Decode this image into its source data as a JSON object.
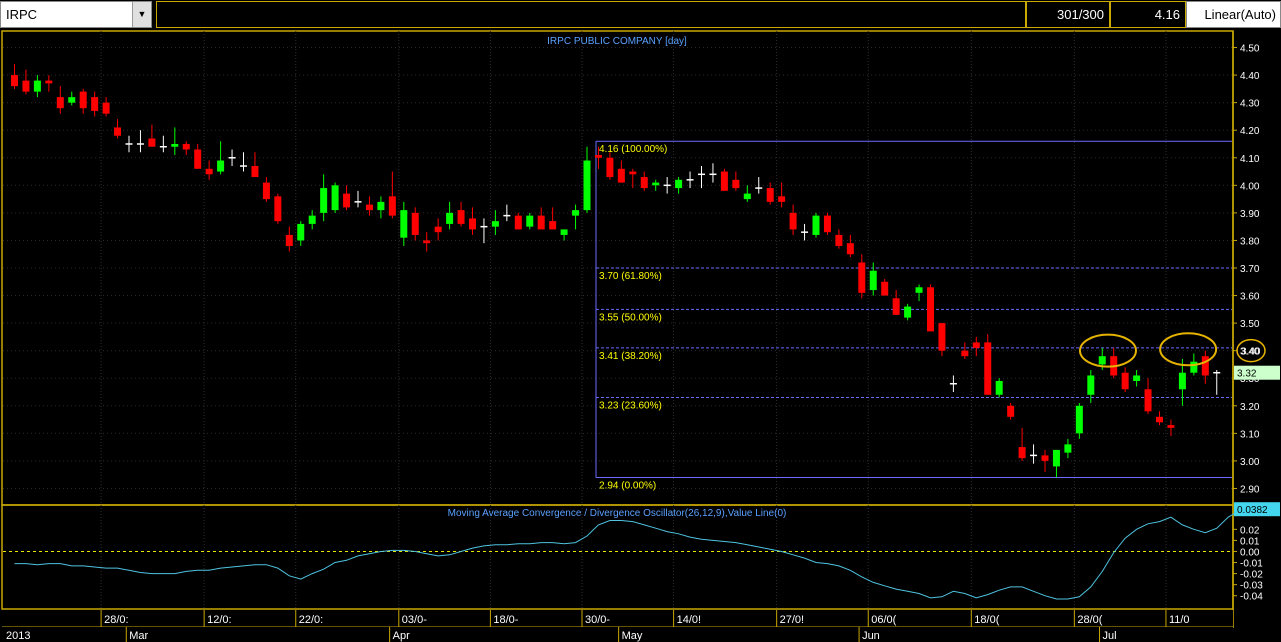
{
  "toolbar": {
    "symbol": "IRPC",
    "bars_count": "301/300",
    "last_value": "4.16",
    "scale_mode": "Linear(Auto)"
  },
  "chart_data": [
    {
      "type": "candlestick",
      "title": "IRPC PUBLIC COMPANY [day]",
      "ylim": [
        2.84,
        4.56
      ],
      "y_ticks": [
        "4.50",
        "4.40",
        "4.30",
        "4.20",
        "4.10",
        "4.00",
        "3.90",
        "3.80",
        "3.70",
        "3.60",
        "3.50",
        "3.40",
        "3.30",
        "3.20",
        "3.10",
        "3.00",
        "2.90"
      ],
      "last_price_label": "3.32",
      "circled_price_label": "3.40",
      "fibonacci": {
        "levels": [
          {
            "price": 4.16,
            "label": "4.16 (100.00%)"
          },
          {
            "price": 3.7,
            "label": "3.70 (61.80%)"
          },
          {
            "price": 3.55,
            "label": "3.55 (50.00%)"
          },
          {
            "price": 3.41,
            "label": "3.41 (38.20%)"
          },
          {
            "price": 3.23,
            "label": "3.23 (23.60%)"
          },
          {
            "price": 2.94,
            "label": "2.94 (0.00%)"
          }
        ]
      },
      "candles": [
        [
          4.4,
          4.44,
          4.35,
          4.36
        ],
        [
          4.38,
          4.42,
          4.33,
          4.34
        ],
        [
          4.34,
          4.4,
          4.32,
          4.38
        ],
        [
          4.38,
          4.4,
          4.34,
          4.37
        ],
        [
          4.32,
          4.36,
          4.26,
          4.28
        ],
        [
          4.3,
          4.34,
          4.29,
          4.32
        ],
        [
          4.34,
          4.35,
          4.26,
          4.28
        ],
        [
          4.32,
          4.34,
          4.25,
          4.27
        ],
        [
          4.3,
          4.32,
          4.25,
          4.26
        ],
        [
          4.21,
          4.24,
          4.17,
          4.18
        ],
        [
          4.15,
          4.18,
          4.12,
          4.15
        ],
        [
          4.15,
          4.2,
          4.12,
          4.15
        ],
        [
          4.17,
          4.22,
          4.14,
          4.14
        ],
        [
          4.14,
          4.18,
          4.12,
          4.14
        ],
        [
          4.14,
          4.21,
          4.11,
          4.15
        ],
        [
          4.15,
          4.16,
          4.11,
          4.13
        ],
        [
          4.13,
          4.15,
          4.06,
          4.06
        ],
        [
          4.06,
          4.09,
          4.02,
          4.04
        ],
        [
          4.05,
          4.16,
          4.04,
          4.09
        ],
        [
          4.1,
          4.13,
          4.07,
          4.1
        ],
        [
          4.07,
          4.12,
          4.05,
          4.07
        ],
        [
          4.07,
          4.12,
          4.03,
          4.03
        ],
        [
          4.01,
          4.03,
          3.94,
          3.95
        ],
        [
          3.96,
          3.97,
          3.86,
          3.87
        ],
        [
          3.82,
          3.85,
          3.76,
          3.78
        ],
        [
          3.8,
          3.87,
          3.78,
          3.86
        ],
        [
          3.86,
          3.91,
          3.84,
          3.89
        ],
        [
          3.9,
          4.04,
          3.87,
          3.99
        ],
        [
          3.91,
          4.01,
          3.9,
          4.0
        ],
        [
          3.97,
          4.0,
          3.91,
          3.92
        ],
        [
          3.94,
          3.98,
          3.92,
          3.94
        ],
        [
          3.93,
          3.96,
          3.89,
          3.91
        ],
        [
          3.91,
          3.96,
          3.88,
          3.94
        ],
        [
          3.96,
          4.05,
          3.88,
          3.89
        ],
        [
          3.81,
          3.94,
          3.78,
          3.91
        ],
        [
          3.9,
          3.92,
          3.8,
          3.82
        ],
        [
          3.8,
          3.83,
          3.76,
          3.79
        ],
        [
          3.85,
          3.88,
          3.8,
          3.83
        ],
        [
          3.86,
          3.94,
          3.84,
          3.9
        ],
        [
          3.91,
          3.94,
          3.85,
          3.86
        ],
        [
          3.88,
          3.92,
          3.82,
          3.84
        ],
        [
          3.85,
          3.88,
          3.79,
          3.85
        ],
        [
          3.85,
          3.91,
          3.82,
          3.87
        ],
        [
          3.89,
          3.93,
          3.87,
          3.89
        ],
        [
          3.89,
          3.9,
          3.84,
          3.84
        ],
        [
          3.85,
          3.9,
          3.84,
          3.89
        ],
        [
          3.89,
          3.92,
          3.84,
          3.84
        ],
        [
          3.87,
          3.92,
          3.86,
          3.84
        ],
        [
          3.82,
          3.84,
          3.8,
          3.84
        ],
        [
          3.89,
          3.93,
          3.84,
          3.91
        ],
        [
          3.91,
          4.14,
          3.9,
          4.09
        ],
        [
          4.11,
          4.14,
          4.06,
          4.1
        ],
        [
          4.1,
          4.12,
          4.02,
          4.03
        ],
        [
          4.06,
          4.09,
          4.01,
          4.01
        ],
        [
          4.05,
          4.06,
          3.99,
          4.04
        ],
        [
          4.03,
          4.05,
          3.98,
          3.99
        ],
        [
          4.0,
          4.02,
          3.98,
          4.01
        ],
        [
          4.0,
          4.03,
          3.97,
          4.0
        ],
        [
          3.99,
          4.03,
          3.97,
          4.02
        ],
        [
          4.02,
          4.05,
          3.99,
          4.02
        ],
        [
          4.04,
          4.07,
          3.99,
          4.04
        ],
        [
          4.04,
          4.08,
          4.01,
          4.04
        ],
        [
          4.05,
          4.06,
          3.99,
          3.98
        ],
        [
          4.02,
          4.05,
          3.98,
          3.99
        ],
        [
          3.95,
          4.0,
          3.94,
          3.97
        ],
        [
          3.99,
          4.03,
          3.97,
          3.99
        ],
        [
          3.99,
          4.01,
          3.93,
          3.94
        ],
        [
          3.96,
          4.01,
          3.92,
          3.94
        ],
        [
          3.9,
          3.93,
          3.82,
          3.84
        ],
        [
          3.83,
          3.86,
          3.8,
          3.83
        ],
        [
          3.82,
          3.9,
          3.81,
          3.89
        ],
        [
          3.89,
          3.9,
          3.82,
          3.83
        ],
        [
          3.82,
          3.84,
          3.77,
          3.78
        ],
        [
          3.79,
          3.82,
          3.74,
          3.75
        ],
        [
          3.72,
          3.75,
          3.59,
          3.61
        ],
        [
          3.62,
          3.72,
          3.6,
          3.69
        ],
        [
          3.65,
          3.66,
          3.6,
          3.6
        ],
        [
          3.59,
          3.62,
          3.53,
          3.53
        ],
        [
          3.52,
          3.57,
          3.51,
          3.56
        ],
        [
          3.61,
          3.64,
          3.58,
          3.63
        ],
        [
          3.63,
          3.64,
          3.47,
          3.47
        ],
        [
          3.5,
          3.5,
          3.38,
          3.4
        ],
        [
          3.28,
          3.31,
          3.25,
          3.28
        ],
        [
          3.4,
          3.43,
          3.37,
          3.38
        ],
        [
          3.43,
          3.45,
          3.38,
          3.41
        ],
        [
          3.43,
          3.46,
          3.24,
          3.24
        ],
        [
          3.24,
          3.3,
          3.23,
          3.29
        ],
        [
          3.2,
          3.21,
          3.15,
          3.16
        ],
        [
          3.05,
          3.12,
          3.0,
          3.01
        ],
        [
          3.02,
          3.06,
          2.99,
          3.02
        ],
        [
          3.02,
          3.04,
          2.96,
          3.0
        ],
        [
          2.98,
          3.03,
          2.94,
          3.04
        ],
        [
          3.03,
          3.08,
          3.01,
          3.06
        ],
        [
          3.1,
          3.21,
          3.08,
          3.2
        ],
        [
          3.24,
          3.33,
          3.21,
          3.31
        ],
        [
          3.35,
          3.41,
          3.33,
          3.38
        ],
        [
          3.38,
          3.41,
          3.3,
          3.31
        ],
        [
          3.32,
          3.34,
          3.25,
          3.26
        ],
        [
          3.29,
          3.33,
          3.27,
          3.31
        ],
        [
          3.26,
          3.3,
          3.17,
          3.18
        ],
        [
          3.16,
          3.18,
          3.13,
          3.14
        ],
        [
          3.13,
          3.15,
          3.09,
          3.12
        ],
        [
          3.26,
          3.37,
          3.2,
          3.32
        ],
        [
          3.32,
          3.39,
          3.31,
          3.36
        ],
        [
          3.38,
          3.4,
          3.28,
          3.31
        ],
        [
          3.32,
          3.33,
          3.24,
          3.32
        ]
      ]
    },
    {
      "type": "line",
      "title": "Moving Average Convergence / Divergence Oscillator(26,12,9),Value Line(0)",
      "ylim": [
        -0.052,
        0.042
      ],
      "y_ticks": [
        "0.02",
        "0.01",
        "0.00",
        "-0.01",
        "-0.02",
        "-0.03",
        "-0.04"
      ],
      "value_line": 0,
      "last_value_label": "0.0382",
      "series": [
        {
          "values": [
            -0.011,
            -0.011,
            -0.012,
            -0.011,
            -0.011,
            -0.013,
            -0.013,
            -0.014,
            -0.015,
            -0.015,
            -0.017,
            -0.019,
            -0.02,
            -0.02,
            -0.02,
            -0.018,
            -0.017,
            -0.017,
            -0.015,
            -0.014,
            -0.013,
            -0.012,
            -0.012,
            -0.015,
            -0.022,
            -0.025,
            -0.02,
            -0.016,
            -0.01,
            -0.008,
            -0.004,
            -0.002,
            0.0,
            0.001,
            0.001,
            0.0,
            -0.002,
            -0.004,
            -0.003,
            0.0,
            0.003,
            0.005,
            0.006,
            0.006,
            0.007,
            0.007,
            0.008,
            0.008,
            0.007,
            0.008,
            0.014,
            0.024,
            0.028,
            0.028,
            0.027,
            0.024,
            0.021,
            0.018,
            0.016,
            0.013,
            0.011,
            0.01,
            0.009,
            0.008,
            0.006,
            0.004,
            0.002,
            0.0,
            -0.003,
            -0.006,
            -0.01,
            -0.011,
            -0.013,
            -0.017,
            -0.023,
            -0.028,
            -0.031,
            -0.034,
            -0.036,
            -0.038,
            -0.042,
            -0.041,
            -0.036,
            -0.038,
            -0.042,
            -0.039,
            -0.035,
            -0.032,
            -0.032,
            -0.036,
            -0.04,
            -0.043,
            -0.043,
            -0.041,
            -0.032,
            -0.018,
            -0.001,
            0.012,
            0.02,
            0.025,
            0.027,
            0.031,
            0.024,
            0.02,
            0.017,
            0.021,
            0.031,
            0.037,
            0.038,
            0.038
          ]
        }
      ]
    }
  ],
  "x_axis": {
    "year_label": "2013",
    "months": [
      {
        "label": "Mar",
        "index": 9.5
      },
      {
        "label": "Apr",
        "index": 32.5
      },
      {
        "label": "May",
        "index": 52.5
      },
      {
        "label": "Jun",
        "index": 73.5
      },
      {
        "label": "Jul",
        "index": 94.5
      }
    ],
    "dates": [
      {
        "label": "28/0:",
        "index": 8
      },
      {
        "label": "12/0:",
        "index": 17
      },
      {
        "label": "22/0:",
        "index": 25
      },
      {
        "label": "03/0-",
        "index": 34
      },
      {
        "label": "18/0-",
        "index": 42
      },
      {
        "label": "30/0-",
        "index": 50
      },
      {
        "label": "14/0!",
        "index": 58
      },
      {
        "label": "27/0!",
        "index": 67
      },
      {
        "label": "06/0(",
        "index": 75
      },
      {
        "label": "18/0(",
        "index": 84
      },
      {
        "label": "28/0(",
        "index": 93
      },
      {
        "label": "11/0",
        "index": 101
      }
    ]
  },
  "annotations": [
    {
      "type": "ellipse",
      "index": 95.5,
      "price": 3.4
    },
    {
      "type": "ellipse",
      "index": 102.5,
      "price": 3.405
    }
  ],
  "colors": {
    "background": "#000000",
    "frame": "#c9a800",
    "up_candle": "#00ff00",
    "down_candle": "#ff0000",
    "doji": "#ffffff",
    "fib_line": "#6a6aff",
    "fib_label": "#ffff00",
    "title_text": "#5aa0ff",
    "macd_line": "#4fc3e0",
    "zero_line": "#e6e600",
    "price_tag": "#ccffcc",
    "macd_tag": "#44d6ee",
    "ellipse": "#e6b400"
  }
}
